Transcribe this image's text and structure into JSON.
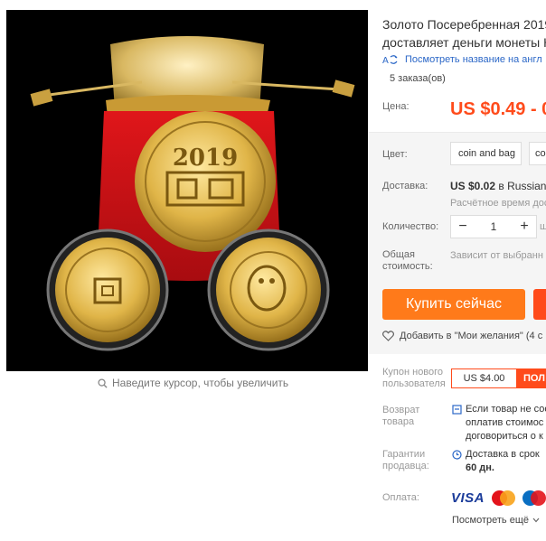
{
  "image": {
    "zoom_hint": "Наведите курсор, чтобы увеличить",
    "coin_year": "2019"
  },
  "product": {
    "title_line1": "Золото Посеребренная 2019",
    "title_line2": "доставляет деньги монеты Ко",
    "translate_link": "Посмотреть название на англ",
    "orders": "5 заказа(ов)"
  },
  "price": {
    "label": "Цена:",
    "value": "US $0.49 - 0"
  },
  "color": {
    "label": "Цвет:",
    "options": [
      "coin and bag",
      "co"
    ]
  },
  "shipping": {
    "label": "Доставка:",
    "price": "US $0.02",
    "dest": "в Russian F",
    "estimate": "Расчётное время дос"
  },
  "quantity": {
    "label": "Количество:",
    "value": "1",
    "minus": "−",
    "plus": "+",
    "unit": "ш"
  },
  "total": {
    "label_line1": "Общая",
    "label_line2": "стоимость:",
    "value": "Зависит от выбранн"
  },
  "buy": {
    "label": "Купить сейчас"
  },
  "wishlist": {
    "label": "Добавить в \"Мои желания\" (4 с"
  },
  "coupon": {
    "label_line1": "Купон нового",
    "label_line2": "пользователя",
    "amount": "US $4.00",
    "get": "ПОЛ"
  },
  "returns": {
    "label_line1": "Возврат",
    "label_line2": "товара",
    "line1": "Если товар не соо",
    "line2": "оплатив стоимос",
    "line3": "договориться о к"
  },
  "guarantee": {
    "label_line1": "Гарантии",
    "label_line2": "продавца:",
    "line1": "Доставка в срок",
    "days": "60 дн."
  },
  "payment": {
    "label": "Оплата:",
    "visa": "VISA",
    "see_all": "Посмотреть ещё"
  },
  "colors": {
    "accent": "#ff4b1b",
    "buy_button": "#ff7a1a",
    "link": "#2b67c7"
  }
}
